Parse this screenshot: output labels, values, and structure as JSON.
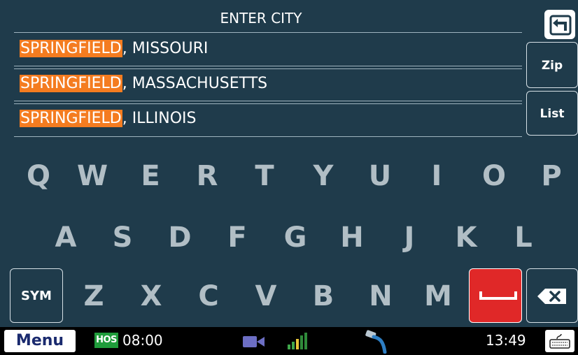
{
  "header": {
    "title": "ENTER CITY"
  },
  "results": [
    {
      "match": "SPRINGFIELD",
      "rest": ", MISSOURI"
    },
    {
      "match": "SPRINGFIELD",
      "rest": ", MASSACHUSETTS"
    },
    {
      "match": "SPRINGFIELD",
      "rest": ", ILLINOIS"
    }
  ],
  "side": {
    "zip_label": "Zip",
    "list_label": "List"
  },
  "keyboard": {
    "row1": [
      "Q",
      "W",
      "E",
      "R",
      "T",
      "Y",
      "U",
      "I",
      "O",
      "P"
    ],
    "row2": [
      "A",
      "S",
      "D",
      "F",
      "G",
      "H",
      "J",
      "K",
      "L"
    ],
    "row3": [
      "Z",
      "X",
      "C",
      "V",
      "B",
      "N",
      "M"
    ],
    "sym_label": "SYM"
  },
  "statusbar": {
    "menu_label": "Menu",
    "hos_label": "HOS",
    "hos_time": "08:00",
    "clock": "13:49"
  },
  "colors": {
    "background": "#1f3b4b",
    "highlight": "#f47c20",
    "space_key": "#e02828",
    "hos_badge": "#1f9c3b"
  },
  "icons": [
    "back-arrow-icon",
    "backspace-icon",
    "camera-icon",
    "signal-icon",
    "cable-icon",
    "keyboard-icon"
  ]
}
